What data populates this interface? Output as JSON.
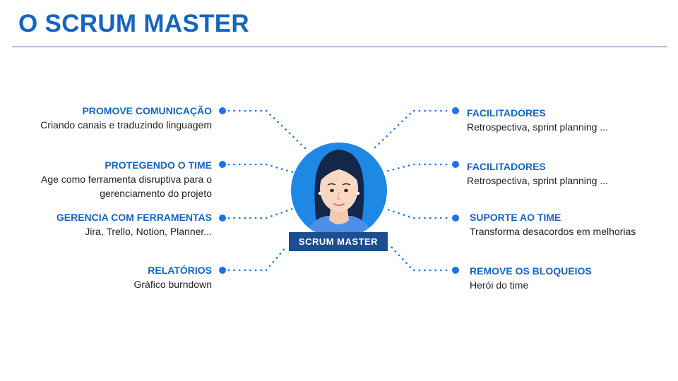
{
  "header": {
    "title": "O SCRUM MASTER"
  },
  "center": {
    "label": "SCRUM MASTER"
  },
  "left_items": [
    {
      "title": "PROMOVE COMUNICAÇÃO",
      "lines": [
        "Criando canais e traduzindo linguagem"
      ]
    },
    {
      "title": "PROTEGENDO O TIME",
      "lines": [
        "Age como ferramenta disruptiva para o",
        "gerenciamento do projeto"
      ]
    },
    {
      "title": "GERENCIA COM FERRAMENTAS",
      "lines": [
        "Jira, Trello, Notion, Planner..."
      ]
    },
    {
      "title": "RELATÓRIOS",
      "lines": [
        "Gráfico burndown"
      ]
    }
  ],
  "right_items": [
    {
      "title": "FACILITADORES",
      "lines": [
        "Retrospectiva, sprint planning ..."
      ]
    },
    {
      "title": "FACILITADORES",
      "lines": [
        "Retrospectiva, sprint planning ..."
      ]
    },
    {
      "title": "SUPORTE AO TIME",
      "lines": [
        "Transforma desacordos em melhorias"
      ]
    },
    {
      "title": "REMOVE OS BLOQUEIOS",
      "lines": [
        "Herói do time"
      ]
    }
  ],
  "colors": {
    "accent": "#1565c0",
    "badge": "#1d4e8f",
    "dot": "#1a73e8",
    "circle": "#1e88e5"
  },
  "icons": {
    "center": "woman-avatar-icon",
    "node": "dot-icon"
  }
}
